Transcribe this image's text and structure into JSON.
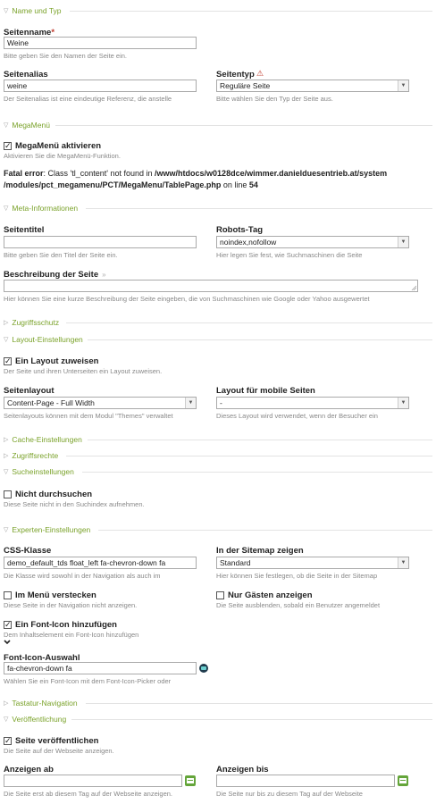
{
  "sections": {
    "name_typ": "Name und Typ",
    "megamenu": "MegaMenü",
    "meta": "Meta-Informationen",
    "zugriffsschutz": "Zugriffsschutz",
    "layout": "Layout-Einstellungen",
    "cache": "Cache-Einstellungen",
    "zugriffsrechte": "Zugriffsrechte",
    "suche": "Sucheinstellungen",
    "experten": "Experten-Einstellungen",
    "tastatur": "Tastatur-Navigation",
    "veroeffentlichung": "Veröffentlichung"
  },
  "fields": {
    "seitenname": {
      "label": "Seitenname",
      "required": "*",
      "value": "Weine",
      "help": "Bitte geben Sie den Namen der Seite ein."
    },
    "seitenalias": {
      "label": "Seitenalias",
      "value": "weine",
      "help": "Der Seitenalias ist eine eindeutige Referenz, die anstelle"
    },
    "seitentyp": {
      "label": "Seitentyp",
      "value": "Reguläre Seite",
      "help": "Bitte wählen Sie den Typ der Seite aus."
    },
    "megamenu_aktivieren": {
      "label": "MegaMenü aktivieren",
      "checked": true,
      "help": "Aktivieren Sie die MegaMenü-Funktion."
    },
    "seitentitel": {
      "label": "Seitentitel",
      "value": "",
      "help": "Bitte geben Sie den Titel der Seite ein."
    },
    "robots": {
      "label": "Robots-Tag",
      "value": "noindex,nofollow",
      "help": "Hier legen Sie fest, wie Suchmaschinen die Seite"
    },
    "beschreibung": {
      "label": "Beschreibung der Seite",
      "help": "Hier können Sie eine kurze Beschreibung der Seite eingeben, die von Suchmaschinen wie Google oder Yahoo ausgewertet"
    },
    "layout_zuweisen": {
      "label": "Ein Layout zuweisen",
      "checked": true,
      "help": "Der Seite und ihren Unterseiten ein Layout zuweisen."
    },
    "seitenlayout": {
      "label": "Seitenlayout",
      "value": "Content-Page - Full Width",
      "help": "Seitenlayouts können mit dem Modul \"Themes\" verwaltet"
    },
    "layout_mobile": {
      "label": "Layout für mobile Seiten",
      "value": "-",
      "help": "Dieses Layout wird verwendet, wenn der Besucher ein"
    },
    "nicht_durchsuchen": {
      "label": "Nicht durchsuchen",
      "checked": false,
      "help": "Diese Seite nicht in den Suchindex aufnehmen."
    },
    "css_klasse": {
      "label": "CSS-Klasse",
      "value": "demo_default_tds float_left fa-chevron-down fa",
      "help": "Die Klasse wird sowohl in der Navigation als auch im"
    },
    "sitemap": {
      "label": "In der Sitemap zeigen",
      "value": "Standard",
      "help": "Hier können Sie festlegen, ob die Seite in der Sitemap"
    },
    "im_menu_verstecken": {
      "label": "Im Menü verstecken",
      "checked": false,
      "help": "Diese Seite in der Navigation nicht anzeigen."
    },
    "nur_gaesten": {
      "label": "Nur Gästen anzeigen",
      "checked": false,
      "help": "Die Seite ausblenden, sobald ein Benutzer angemeldet"
    },
    "font_icon": {
      "label": "Ein Font-Icon hinzufügen",
      "checked": true,
      "help": "Dem Inhaltselement ein Font-Icon hinzufügen"
    },
    "font_icon_auswahl": {
      "label": "Font-Icon-Auswahl",
      "value": "fa-chevron-down fa",
      "help": "Wählen Sie ein Font-Icon mit dem Font-Icon-Picker oder"
    },
    "seite_veroeffentlichen": {
      "label": "Seite veröffentlichen",
      "checked": true,
      "help": "Die Seite auf der Webseite anzeigen."
    },
    "anzeigen_ab": {
      "label": "Anzeigen ab",
      "value": "",
      "help": "Die Seite erst ab diesem Tag auf der Webseite anzeigen."
    },
    "anzeigen_bis": {
      "label": "Anzeigen bis",
      "value": "",
      "help": "Die Seite nur bis zu diesem Tag auf der Webseite"
    }
  },
  "error": {
    "prefix": "Fatal error",
    "message": ": Class 'tl_content' not found in ",
    "path": "/www/htdocs/w0128dce/wimmer.danielduesentrieb.at/system /modules/pct_megamenu/PCT/MegaMenu/TablePage.php",
    "online": " on line ",
    "line": "54"
  },
  "colors": {
    "accent": "#7aa22a",
    "required": "#c0392b",
    "calendar": "#64a53a"
  }
}
